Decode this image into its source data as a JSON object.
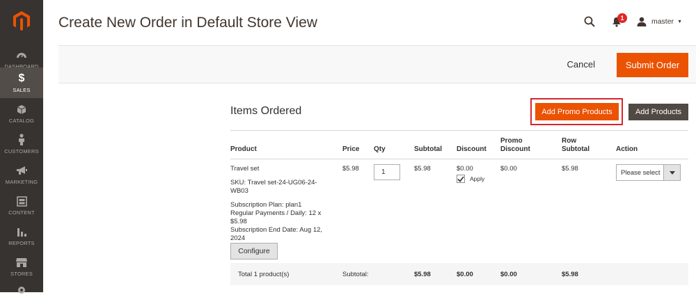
{
  "page": {
    "title": "Create New Order in Default Store View"
  },
  "header": {
    "notifications_count": "1",
    "user": "master"
  },
  "sidebar": {
    "items": [
      {
        "label": "DASHBOARD",
        "icon": "dashboard-icon",
        "active": false
      },
      {
        "label": "SALES",
        "icon": "dollar-icon",
        "active": true
      },
      {
        "label": "CATALOG",
        "icon": "cube-icon",
        "active": false
      },
      {
        "label": "CUSTOMERS",
        "icon": "person-icon",
        "active": false
      },
      {
        "label": "MARKETING",
        "icon": "megaphone-icon",
        "active": false
      },
      {
        "label": "CONTENT",
        "icon": "layout-icon",
        "active": false
      },
      {
        "label": "REPORTS",
        "icon": "bar-chart-icon",
        "active": false
      },
      {
        "label": "STORES",
        "icon": "storefront-icon",
        "active": false
      }
    ]
  },
  "actions": {
    "cancel": "Cancel",
    "submit": "Submit Order"
  },
  "items_section": {
    "title": "Items Ordered",
    "add_promo": "Add Promo Products",
    "add_products": "Add Products",
    "columns": {
      "product": "Product",
      "price": "Price",
      "qty": "Qty",
      "subtotal": "Subtotal",
      "discount": "Discount",
      "promo_discount_1": "Promo",
      "promo_discount_2": "Discount",
      "row_subtotal_1": "Row",
      "row_subtotal_2": "Subtotal",
      "action": "Action"
    },
    "row": {
      "name": "Travel set",
      "sku_1": "SKU: Travel set-24-UG06-24-",
      "sku_2": "WB03",
      "plan": "Subscription Plan: plan1",
      "payments_1": "Regular Payments / Daily: 12 x",
      "payments_2": "$5.98",
      "end_1": "Subscription End Date: Aug 12,",
      "end_2": "2024",
      "configure": "Configure",
      "price": "$5.98",
      "qty": "1",
      "subtotal": "$5.98",
      "discount": "$0.00",
      "apply_label": "Apply",
      "apply_checked": true,
      "promo_discount": "$0.00",
      "row_subtotal": "$5.98",
      "action_placeholder": "Please select"
    },
    "totals": {
      "label": "Total 1 product(s)",
      "subtotal_label": "Subtotal:",
      "subtotal": "$5.98",
      "discount": "$0.00",
      "promo_discount": "$0.00",
      "row_subtotal": "$5.98"
    }
  },
  "colors": {
    "sidebar_bg": "#373330",
    "accent": "#eb5202",
    "dark_button": "#514943",
    "highlight_frame": "#d9242c",
    "notification": "#e22626"
  }
}
